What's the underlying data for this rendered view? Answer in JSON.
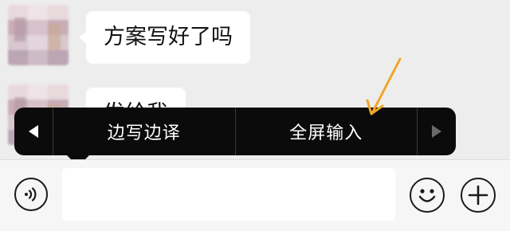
{
  "messages": [
    {
      "text": "方案写好了吗"
    },
    {
      "text": "发给我"
    }
  ],
  "context_menu": {
    "items": [
      {
        "label": "边写边译"
      },
      {
        "label": "全屏输入"
      }
    ],
    "prev_icon": "triangle-left-icon",
    "next_icon": "triangle-right-icon"
  },
  "input_bar": {
    "value": "",
    "voice_icon": "voice-icon",
    "emoji_icon": "emoji-icon",
    "plus_icon": "plus-icon"
  },
  "colors": {
    "background": "#ededed",
    "bubble": "#ffffff",
    "menu": "#0b0b0b",
    "annotation_arrow": "#f0a52a"
  }
}
